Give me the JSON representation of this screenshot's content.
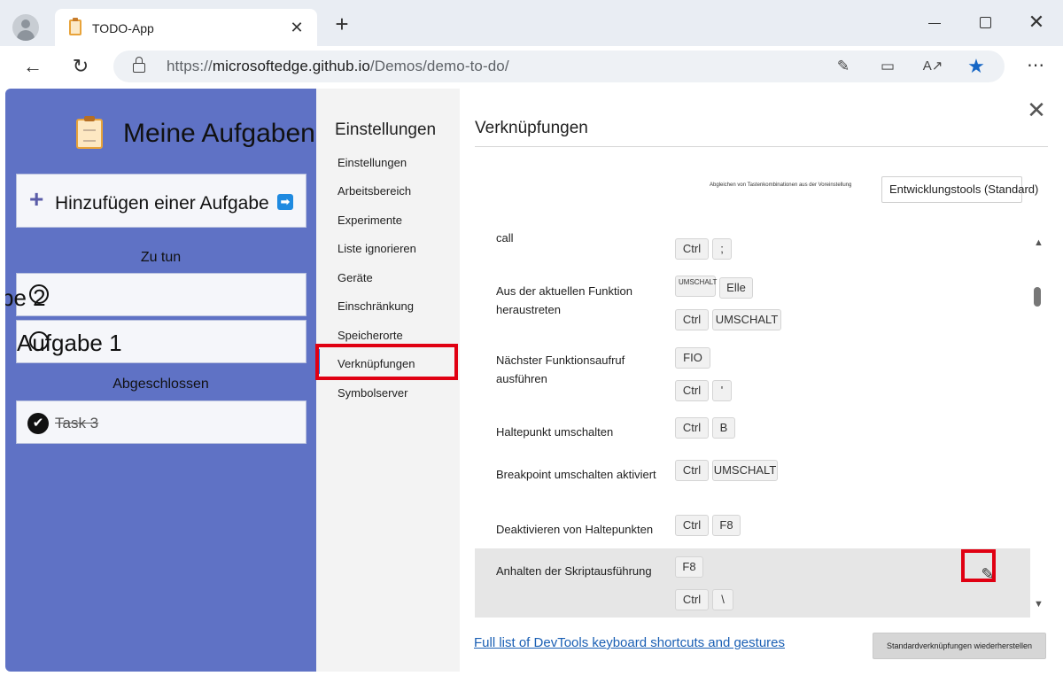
{
  "browser": {
    "tab_title": "TODO-App",
    "tab_close": "✕",
    "new_tab": "+",
    "url_prefix": "https://",
    "url_host": "microsoftedge.github.io",
    "url_path": "/Demos/demo-to-do/"
  },
  "todo": {
    "title": "Meine Aufgaben",
    "add_task_label": "Hinzufügen einer Aufgabe",
    "todo_heading": "Zu tun",
    "done_heading": "Abgeschlossen",
    "tasks_open": [
      "be 2",
      "Aufgabe 1"
    ],
    "tasks_done": [
      "Task 3"
    ]
  },
  "settings": {
    "title": "Einstellungen",
    "nav": [
      "Einstellungen",
      "Arbeitsbereich",
      "Experimente",
      "Liste ignorieren",
      "Geräte",
      "Einschränkung",
      "Speicherorte",
      "Verknüpfungen",
      "Symbolserver"
    ],
    "active_index": 7
  },
  "shortcuts": {
    "title": "Verknüpfungen",
    "preset_label": "Abgleichen von Tastenkombinationen aus der Voreinstellung",
    "preset_value": "Entwicklungstools (Standard)",
    "rows": [
      {
        "name": "call",
        "keys": [
          [
            "Ctrl",
            ";"
          ]
        ]
      },
      {
        "name": "Aus der aktuellen Funktion heraustreten",
        "keys": [
          [
            "UMSCHALT",
            "Elle"
          ],
          [
            "Ctrl",
            "UMSCHALT"
          ]
        ]
      },
      {
        "name": "Nächster Funktionsaufruf ausführen",
        "keys": [
          [
            "FIO"
          ],
          [
            "Ctrl",
            "'"
          ]
        ]
      },
      {
        "name": "Haltepunkt umschalten",
        "keys": [
          [
            "Ctrl",
            "B"
          ]
        ]
      },
      {
        "name": "Breakpoint umschalten aktiviert",
        "keys": [
          [
            "Ctrl",
            "UMSCHALT"
          ]
        ]
      },
      {
        "name": "Deaktivieren von Haltepunkten",
        "keys": [
          [
            "Ctrl",
            "F8"
          ]
        ]
      },
      {
        "name": "Anhalten der Skriptausführung",
        "keys": [
          [
            "F8"
          ],
          [
            "Ctrl",
            "\\"
          ]
        ]
      }
    ],
    "full_list_link": "Full list of DevTools keyboard shortcuts and gestures",
    "restore_button": "Standardverknüpfungen wiederherstellen"
  },
  "colors": {
    "todo_bg": "#5f72c5",
    "accent": "#1a73e8",
    "highlight_box": "#e00012"
  }
}
